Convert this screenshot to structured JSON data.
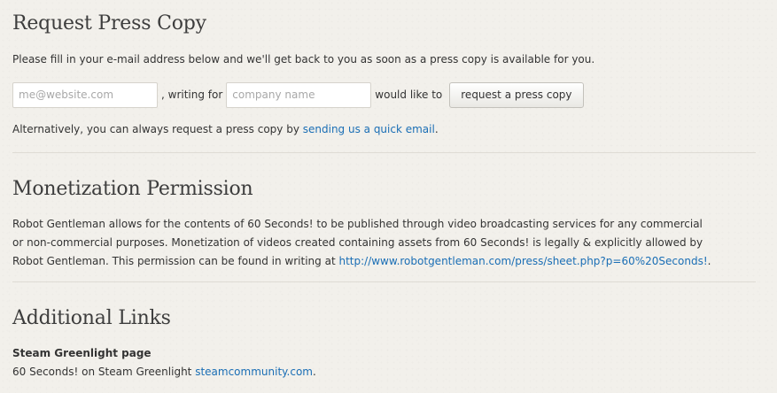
{
  "press_copy": {
    "title": "Request Press Copy",
    "intro": "Please fill in your e-mail address below and we'll get back to you as soon as a press copy is available for you.",
    "email_placeholder": "me@website.com",
    "writing_for": ", writing for",
    "company_placeholder": "company name",
    "would_like_to": "would like to",
    "button_label": "request a press copy",
    "alt_prefix": "Alternatively, you can always request a press copy by ",
    "alt_link": "sending us a quick email",
    "alt_suffix": "."
  },
  "monetization": {
    "title": "Monetization Permission",
    "body": "Robot Gentleman allows for the contents of 60 Seconds! to be published through video broadcasting services for any commercial or non-commercial purposes. Monetization of videos created containing assets from 60 Seconds! is legally & explicitly allowed by Robot Gentleman. This permission can be found in writing at ",
    "link": "http://www.robotgentleman.com/press/sheet.php?p=60%20Seconds!",
    "suffix": "."
  },
  "additional_links": {
    "title": "Additional Links",
    "item_title": "Steam Greenlight page",
    "item_prefix": "60 Seconds! on Steam Greenlight ",
    "item_link": "steamcommunity.com",
    "item_suffix": "."
  }
}
